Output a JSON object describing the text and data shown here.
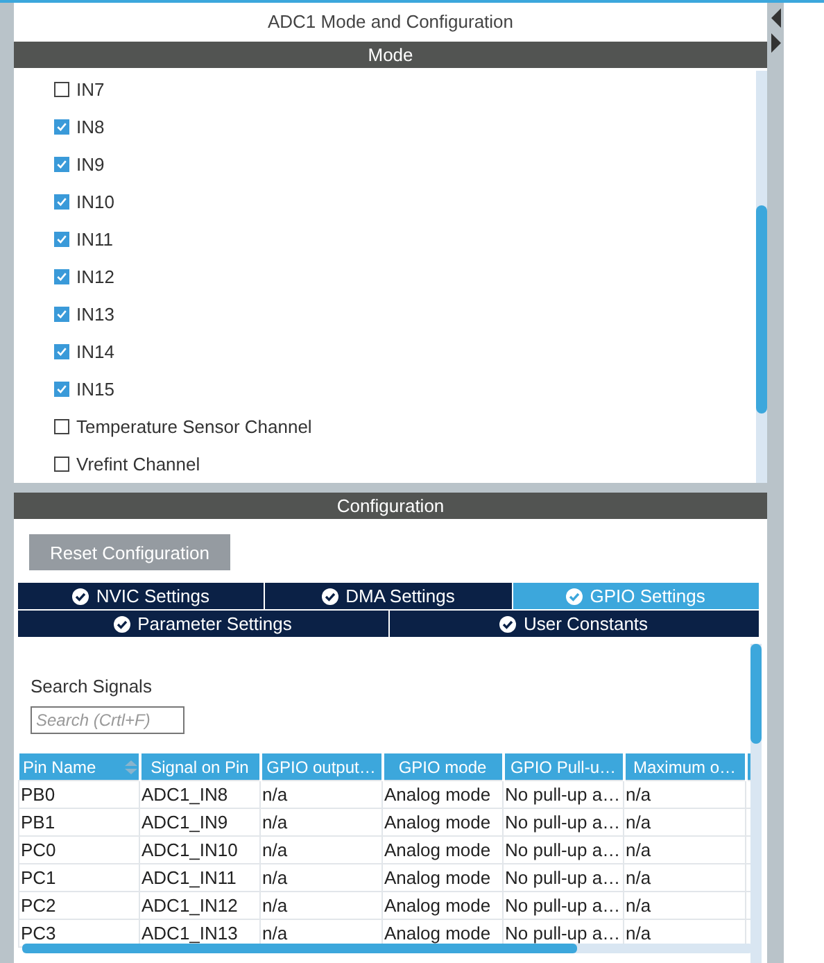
{
  "panel": {
    "title": "ADC1 Mode and Configuration"
  },
  "mode": {
    "header": "Mode",
    "channels": [
      {
        "label": "IN7",
        "checked": false
      },
      {
        "label": "IN8",
        "checked": true
      },
      {
        "label": "IN9",
        "checked": true
      },
      {
        "label": "IN10",
        "checked": true
      },
      {
        "label": "IN11",
        "checked": true
      },
      {
        "label": "IN12",
        "checked": true
      },
      {
        "label": "IN13",
        "checked": true
      },
      {
        "label": "IN14",
        "checked": true
      },
      {
        "label": "IN15",
        "checked": true
      },
      {
        "label": "Temperature Sensor Channel",
        "checked": false
      },
      {
        "label": "Vrefint Channel",
        "checked": false
      }
    ]
  },
  "configuration": {
    "header": "Configuration",
    "reset_button": "Reset Configuration",
    "tab_rows": [
      [
        {
          "label": "NVIC Settings",
          "selected": false
        },
        {
          "label": "DMA Settings",
          "selected": false
        },
        {
          "label": "GPIO Settings",
          "selected": true
        }
      ],
      [
        {
          "label": "Parameter Settings",
          "selected": false
        },
        {
          "label": "User Constants",
          "selected": false
        }
      ]
    ],
    "search": {
      "label": "Search Signals",
      "placeholder": "Search (Crtl+F)"
    },
    "table": {
      "columns": [
        {
          "label": "Pin Name",
          "sortable": true
        },
        {
          "label": "Signal on Pin",
          "sortable": false
        },
        {
          "label": "GPIO output…",
          "sortable": false
        },
        {
          "label": "GPIO mode",
          "sortable": false
        },
        {
          "label": "GPIO Pull-u…",
          "sortable": false
        },
        {
          "label": "Maximum o…",
          "sortable": false
        }
      ],
      "rows": [
        [
          "PB0",
          "ADC1_IN8",
          "n/a",
          "Analog mode",
          "No pull-up a…",
          "n/a"
        ],
        [
          "PB1",
          "ADC1_IN9",
          "n/a",
          "Analog mode",
          "No pull-up a…",
          "n/a"
        ],
        [
          "PC0",
          "ADC1_IN10",
          "n/a",
          "Analog mode",
          "No pull-up a…",
          "n/a"
        ],
        [
          "PC1",
          "ADC1_IN11",
          "n/a",
          "Analog mode",
          "No pull-up a…",
          "n/a"
        ],
        [
          "PC2",
          "ADC1_IN12",
          "n/a",
          "Analog mode",
          "No pull-up a…",
          "n/a"
        ],
        [
          "PC3",
          "ADC1_IN13",
          "n/a",
          "Analog mode",
          "No pull-up a…",
          "n/a"
        ]
      ]
    }
  }
}
